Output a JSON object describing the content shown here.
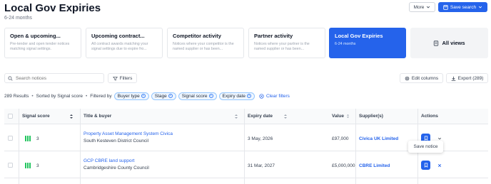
{
  "header": {
    "title": "Local Gov Expiries",
    "subtitle": "6-24 months",
    "more_label": "More",
    "save_search_label": "Save search"
  },
  "cards": [
    {
      "title": "Open & upcoming...",
      "desc": "Pre-tender and open tender notices matching signal settings."
    },
    {
      "title": "Upcoming contract...",
      "desc": "All contract awards matching your signal settings due to expire fro..."
    },
    {
      "title": "Competitor activity",
      "desc": "Notices where your competitor is the named supplier or has been..."
    },
    {
      "title": "Partner activity",
      "desc": "Notices where your partner is the named supplier or has been..."
    },
    {
      "title": "Local Gov Expiries",
      "desc": "6-24 months"
    },
    {
      "title": "All views",
      "desc": ""
    }
  ],
  "toolbar": {
    "search_placeholder": "Search notices",
    "filters_label": "Filters",
    "edit_columns_label": "Edit columns",
    "export_label": "Export (289)"
  },
  "results": {
    "count_text": "289 Results",
    "sorted_text": "Sorted by Signal score",
    "filtered_text": "Filtered by",
    "chips": [
      "Buyer type",
      "Stage",
      "Signal score",
      "Expiry date"
    ],
    "clear_label": "Clear filters"
  },
  "table": {
    "columns": [
      "Signal score",
      "Title & buyer",
      "Expiry date",
      "Value",
      "Supplier(s)",
      "Actions"
    ],
    "rows": [
      {
        "score": "3",
        "title": "Property Asset Management System Civica",
        "buyer": "South Kesteven District Council",
        "expiry": "3 May, 2026",
        "value": "£97,000",
        "supplier": "Civica UK Limited"
      },
      {
        "score": "3",
        "title": "GCP CBRE land support",
        "buyer": "Cambridgeshire County Council",
        "expiry": "31 Mar, 2027",
        "value": "£5,000,000",
        "supplier": "CBRE Limited"
      }
    ],
    "tooltip": "Save notice"
  },
  "colors": {
    "accent": "#2563eb",
    "signal": "#22c55e"
  },
  "icons": [
    "chevron-down-icon",
    "save-icon",
    "search-icon",
    "filter-icon",
    "settings-icon",
    "download-icon",
    "clear-icon",
    "sort-icon",
    "bookmark-icon",
    "close-icon",
    "bookmark-outline-icon"
  ]
}
